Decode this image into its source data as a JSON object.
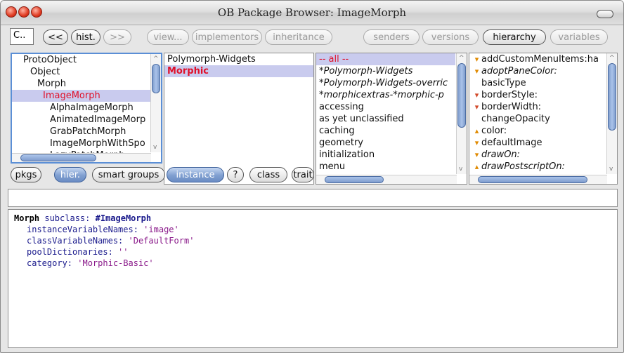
{
  "window": {
    "title": "OB Package Browser: ImageMorph"
  },
  "toolbar": {
    "search_text": "C..",
    "buttons": [
      "<<",
      "hist.",
      ">>",
      "view...",
      "implementors",
      "inheritance",
      "senders",
      "versions",
      "hierarchy",
      "variables"
    ]
  },
  "classes_pane": {
    "items": [
      "ProtoObject",
      "Object",
      "Morph",
      "ImageMorph",
      "AlphaImageMorph",
      "AnimatedImageMorp",
      "GrabPatchMorph",
      "ImageMorphWithSpo",
      "LazyPatchMorph"
    ],
    "selected": "ImageMorph"
  },
  "packages_pane": {
    "items": [
      "Polymorph-Widgets",
      "Morphic"
    ],
    "selected": "Morphic"
  },
  "categories_pane": {
    "items": [
      "-- all --",
      "*Polymorph-Widgets",
      "*Polymorph-Widgets-overric",
      "*morphicextras-*morphic-p",
      "accessing",
      "as yet unclassified",
      "caching",
      "geometry",
      "initialization",
      "menu"
    ]
  },
  "methods_pane": {
    "items": [
      "addCustomMenuItems:ha",
      "adoptPaneColor:",
      "basicType",
      "borderStyle:",
      "borderWidth:",
      "changeOpacity",
      "color:",
      "defaultImage",
      "drawOn:",
      "drawPostscriptOn:"
    ]
  },
  "mode_buttons": {
    "left": [
      "pkgs",
      "hier.",
      "smart groups"
    ],
    "right": [
      "instance",
      "?",
      "class",
      "trait"
    ]
  },
  "code": {
    "l1_class": "Morph",
    "l1_sel": " subclass: ",
    "l1_sym": "#ImageMorph",
    "l2_key": "instanceVariableNames: ",
    "l2_val": "'image'",
    "l3_key": "classVariableNames: ",
    "l3_val": "'DefaultForm'",
    "l4_key": "poolDictionaries: ",
    "l4_val": "''",
    "l5_key": "category: ",
    "l5_val": "'Morphic-Basic'"
  },
  "colors": {
    "selection": "#c9cbee",
    "highlight_text": "#e0102a",
    "scroll_thumb": "#7f9ccc",
    "focus_border": "#5b8fd6"
  }
}
